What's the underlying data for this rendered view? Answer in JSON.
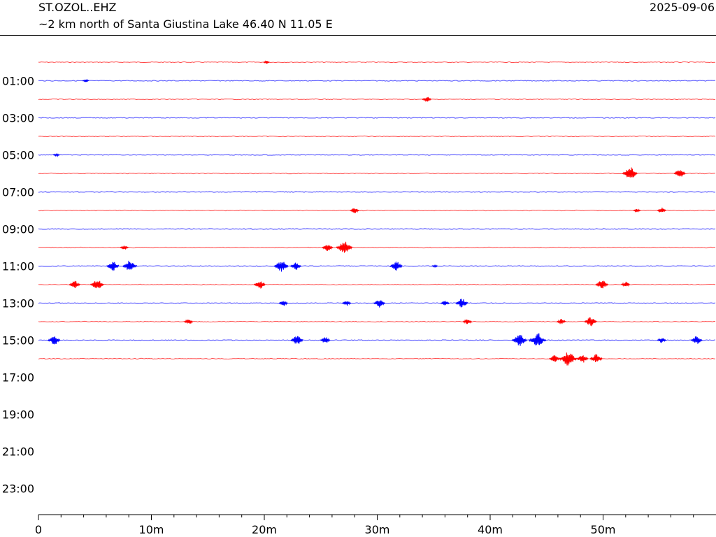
{
  "header": {
    "station": "ST.OZOL..EHZ",
    "location": "~2 km north of Santa Giustina Lake  46.40 N 11.05 E",
    "date": "2025-09-06"
  },
  "chart_data": {
    "type": "line",
    "title": "ST.OZOL..EHZ",
    "subtitle": "~2 km north of Santa Giustina Lake  46.40 N 11.05 E",
    "xlabel": "",
    "ylabel": "",
    "xlim": [
      0,
      60
    ],
    "x_ticks": [
      {
        "value": 0,
        "label": "0"
      },
      {
        "value": 10,
        "label": "10m"
      },
      {
        "value": 20,
        "label": "20m"
      },
      {
        "value": 30,
        "label": "30m"
      },
      {
        "value": 40,
        "label": "40m"
      },
      {
        "value": 50,
        "label": "50m"
      }
    ],
    "y_ticks": [
      "01:00",
      "03:00",
      "05:00",
      "07:00",
      "09:00",
      "11:00",
      "13:00",
      "15:00",
      "17:00",
      "19:00",
      "21:00",
      "23:00"
    ],
    "colors": {
      "even_hour": "#ff0000",
      "odd_hour": "#0000ff"
    },
    "grid": false,
    "series": [
      {
        "hour": 0,
        "color": "#ff0000",
        "events": [
          {
            "t": 20.2,
            "amp": 0.3
          }
        ]
      },
      {
        "hour": 1,
        "color": "#0000ff",
        "events": [
          {
            "t": 4.2,
            "amp": 0.3
          }
        ]
      },
      {
        "hour": 2,
        "color": "#ff0000",
        "events": [
          {
            "t": 34.4,
            "amp": 0.6
          }
        ]
      },
      {
        "hour": 3,
        "color": "#0000ff",
        "events": []
      },
      {
        "hour": 4,
        "color": "#ff0000",
        "events": []
      },
      {
        "hour": 5,
        "color": "#0000ff",
        "events": [
          {
            "t": 1.6,
            "amp": 0.3
          }
        ]
      },
      {
        "hour": 6,
        "color": "#ff0000",
        "events": [
          {
            "t": 52.4,
            "amp": 1.3
          },
          {
            "t": 56.8,
            "amp": 0.9
          }
        ]
      },
      {
        "hour": 7,
        "color": "#0000ff",
        "events": []
      },
      {
        "hour": 8,
        "color": "#ff0000",
        "events": [
          {
            "t": 28.0,
            "amp": 0.6
          },
          {
            "t": 53.0,
            "amp": 0.4
          },
          {
            "t": 55.2,
            "amp": 0.6
          }
        ]
      },
      {
        "hour": 9,
        "color": "#0000ff",
        "events": []
      },
      {
        "hour": 10,
        "color": "#ff0000",
        "events": [
          {
            "t": 7.6,
            "amp": 0.5
          },
          {
            "t": 25.6,
            "amp": 0.8
          },
          {
            "t": 27.1,
            "amp": 1.4
          }
        ]
      },
      {
        "hour": 11,
        "color": "#0000ff",
        "events": [
          {
            "t": 6.6,
            "amp": 1.0
          },
          {
            "t": 8.1,
            "amp": 1.2
          },
          {
            "t": 21.5,
            "amp": 1.2
          },
          {
            "t": 22.8,
            "amp": 0.8
          },
          {
            "t": 31.7,
            "amp": 1.0
          },
          {
            "t": 35.1,
            "amp": 0.3
          }
        ]
      },
      {
        "hour": 12,
        "color": "#ff0000",
        "events": [
          {
            "t": 3.2,
            "amp": 0.8
          },
          {
            "t": 5.2,
            "amp": 1.1
          },
          {
            "t": 19.6,
            "amp": 0.9
          },
          {
            "t": 49.9,
            "amp": 1.0
          },
          {
            "t": 52.0,
            "amp": 0.6
          }
        ]
      },
      {
        "hour": 13,
        "color": "#0000ff",
        "events": [
          {
            "t": 21.7,
            "amp": 0.6
          },
          {
            "t": 27.3,
            "amp": 0.6
          },
          {
            "t": 30.2,
            "amp": 0.9
          },
          {
            "t": 36.0,
            "amp": 0.6
          },
          {
            "t": 37.5,
            "amp": 1.0
          }
        ]
      },
      {
        "hour": 14,
        "color": "#ff0000",
        "events": [
          {
            "t": 13.3,
            "amp": 0.6
          },
          {
            "t": 38.0,
            "amp": 0.6
          },
          {
            "t": 46.3,
            "amp": 0.6
          },
          {
            "t": 48.9,
            "amp": 1.0
          }
        ]
      },
      {
        "hour": 15,
        "color": "#0000ff",
        "events": [
          {
            "t": 1.4,
            "amp": 1.0
          },
          {
            "t": 22.9,
            "amp": 1.0
          },
          {
            "t": 25.4,
            "amp": 0.7
          },
          {
            "t": 42.6,
            "amp": 1.3
          },
          {
            "t": 44.2,
            "amp": 1.5
          },
          {
            "t": 55.2,
            "amp": 0.6
          },
          {
            "t": 58.3,
            "amp": 0.9
          }
        ]
      },
      {
        "hour": 16,
        "color": "#ff0000",
        "events": [
          {
            "t": 45.7,
            "amp": 0.8
          },
          {
            "t": 46.9,
            "amp": 1.6
          },
          {
            "t": 48.2,
            "amp": 0.9
          },
          {
            "t": 49.4,
            "amp": 1.0
          }
        ]
      }
    ]
  }
}
